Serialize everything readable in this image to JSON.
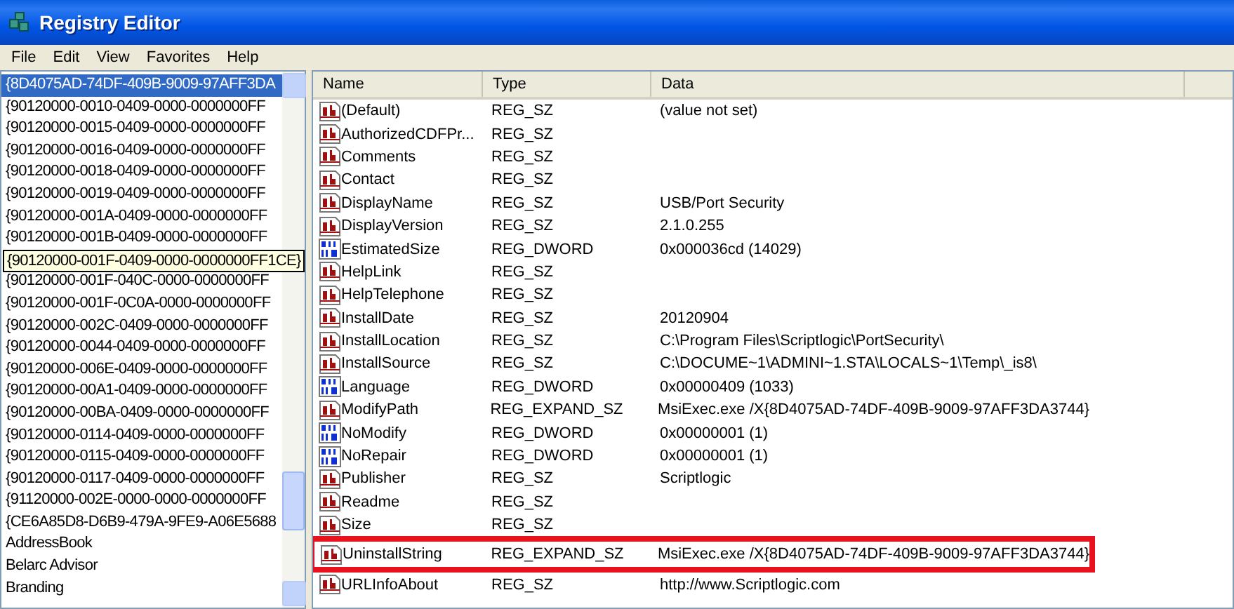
{
  "window": {
    "title": "Registry Editor"
  },
  "menu": [
    "File",
    "Edit",
    "View",
    "Favorites",
    "Help"
  ],
  "tree": {
    "items": [
      {
        "label": "{8D4075AD-74DF-409B-9009-97AFF3DA",
        "selected": true,
        "tooltip": false
      },
      {
        "label": "{90120000-0010-0409-0000-0000000FF",
        "selected": false,
        "tooltip": false
      },
      {
        "label": "{90120000-0015-0409-0000-0000000FF",
        "selected": false,
        "tooltip": false
      },
      {
        "label": "{90120000-0016-0409-0000-0000000FF",
        "selected": false,
        "tooltip": false
      },
      {
        "label": "{90120000-0018-0409-0000-0000000FF",
        "selected": false,
        "tooltip": false
      },
      {
        "label": "{90120000-0019-0409-0000-0000000FF",
        "selected": false,
        "tooltip": false
      },
      {
        "label": "{90120000-001A-0409-0000-0000000FF",
        "selected": false,
        "tooltip": false
      },
      {
        "label": "{90120000-001B-0409-0000-0000000FF",
        "selected": false,
        "tooltip": false
      },
      {
        "label": "{90120000-001F-0409-0000-0000000FF1CE}",
        "selected": false,
        "tooltip": true
      },
      {
        "label": "{90120000-001F-040C-0000-0000000FF",
        "selected": false,
        "tooltip": false
      },
      {
        "label": "{90120000-001F-0C0A-0000-0000000FF",
        "selected": false,
        "tooltip": false
      },
      {
        "label": "{90120000-002C-0409-0000-0000000FF",
        "selected": false,
        "tooltip": false
      },
      {
        "label": "{90120000-0044-0409-0000-0000000FF",
        "selected": false,
        "tooltip": false
      },
      {
        "label": "{90120000-006E-0409-0000-0000000FF",
        "selected": false,
        "tooltip": false
      },
      {
        "label": "{90120000-00A1-0409-0000-0000000FF",
        "selected": false,
        "tooltip": false
      },
      {
        "label": "{90120000-00BA-0409-0000-0000000FF",
        "selected": false,
        "tooltip": false
      },
      {
        "label": "{90120000-0114-0409-0000-0000000FF",
        "selected": false,
        "tooltip": false
      },
      {
        "label": "{90120000-0115-0409-0000-0000000FF",
        "selected": false,
        "tooltip": false
      },
      {
        "label": "{90120000-0117-0409-0000-0000000FF",
        "selected": false,
        "tooltip": false
      },
      {
        "label": "{91120000-002E-0000-0000-0000000FF",
        "selected": false,
        "tooltip": false
      },
      {
        "label": "{CE6A85D8-D6B9-479A-9FE9-A06E5688",
        "selected": false,
        "tooltip": false
      },
      {
        "label": "AddressBook",
        "selected": false,
        "tooltip": false
      },
      {
        "label": "Belarc Advisor",
        "selected": false,
        "tooltip": false
      },
      {
        "label": "Branding",
        "selected": false,
        "tooltip": false
      }
    ]
  },
  "values": {
    "columns": [
      "Name",
      "Type",
      "Data"
    ],
    "rows": [
      {
        "kind": "string",
        "name": "(Default)",
        "type": "REG_SZ",
        "data": "(value not set)",
        "highlighted": false
      },
      {
        "kind": "string",
        "name": "AuthorizedCDFPr...",
        "type": "REG_SZ",
        "data": "",
        "highlighted": false
      },
      {
        "kind": "string",
        "name": "Comments",
        "type": "REG_SZ",
        "data": "",
        "highlighted": false
      },
      {
        "kind": "string",
        "name": "Contact",
        "type": "REG_SZ",
        "data": "",
        "highlighted": false
      },
      {
        "kind": "string",
        "name": "DisplayName",
        "type": "REG_SZ",
        "data": "USB/Port Security",
        "highlighted": false
      },
      {
        "kind": "string",
        "name": "DisplayVersion",
        "type": "REG_SZ",
        "data": "2.1.0.255",
        "highlighted": false
      },
      {
        "kind": "binary",
        "name": "EstimatedSize",
        "type": "REG_DWORD",
        "data": "0x000036cd (14029)",
        "highlighted": false
      },
      {
        "kind": "string",
        "name": "HelpLink",
        "type": "REG_SZ",
        "data": "",
        "highlighted": false
      },
      {
        "kind": "string",
        "name": "HelpTelephone",
        "type": "REG_SZ",
        "data": "",
        "highlighted": false
      },
      {
        "kind": "string",
        "name": "InstallDate",
        "type": "REG_SZ",
        "data": "20120904",
        "highlighted": false
      },
      {
        "kind": "string",
        "name": "InstallLocation",
        "type": "REG_SZ",
        "data": "C:\\Program Files\\Scriptlogic\\PortSecurity\\",
        "highlighted": false
      },
      {
        "kind": "string",
        "name": "InstallSource",
        "type": "REG_SZ",
        "data": "C:\\DOCUME~1\\ADMINI~1.STA\\LOCALS~1\\Temp\\_is8\\",
        "highlighted": false
      },
      {
        "kind": "binary",
        "name": "Language",
        "type": "REG_DWORD",
        "data": "0x00000409 (1033)",
        "highlighted": false
      },
      {
        "kind": "string",
        "name": "ModifyPath",
        "type": "REG_EXPAND_SZ",
        "data": "MsiExec.exe /X{8D4075AD-74DF-409B-9009-97AFF3DA3744}",
        "highlighted": false
      },
      {
        "kind": "binary",
        "name": "NoModify",
        "type": "REG_DWORD",
        "data": "0x00000001 (1)",
        "highlighted": false
      },
      {
        "kind": "binary",
        "name": "NoRepair",
        "type": "REG_DWORD",
        "data": "0x00000001 (1)",
        "highlighted": false
      },
      {
        "kind": "string",
        "name": "Publisher",
        "type": "REG_SZ",
        "data": "Scriptlogic",
        "highlighted": false
      },
      {
        "kind": "string",
        "name": "Readme",
        "type": "REG_SZ",
        "data": "",
        "highlighted": false
      },
      {
        "kind": "string",
        "name": "Size",
        "type": "REG_SZ",
        "data": "",
        "highlighted": false
      },
      {
        "kind": "string",
        "name": "UninstallString",
        "type": "REG_EXPAND_SZ",
        "data": "MsiExec.exe /X{8D4075AD-74DF-409B-9009-97AFF3DA3744}",
        "highlighted": true
      },
      {
        "kind": "string",
        "name": "URLInfoAbout",
        "type": "REG_SZ",
        "data": "http://www.Scriptlogic.com",
        "highlighted": false
      }
    ]
  }
}
